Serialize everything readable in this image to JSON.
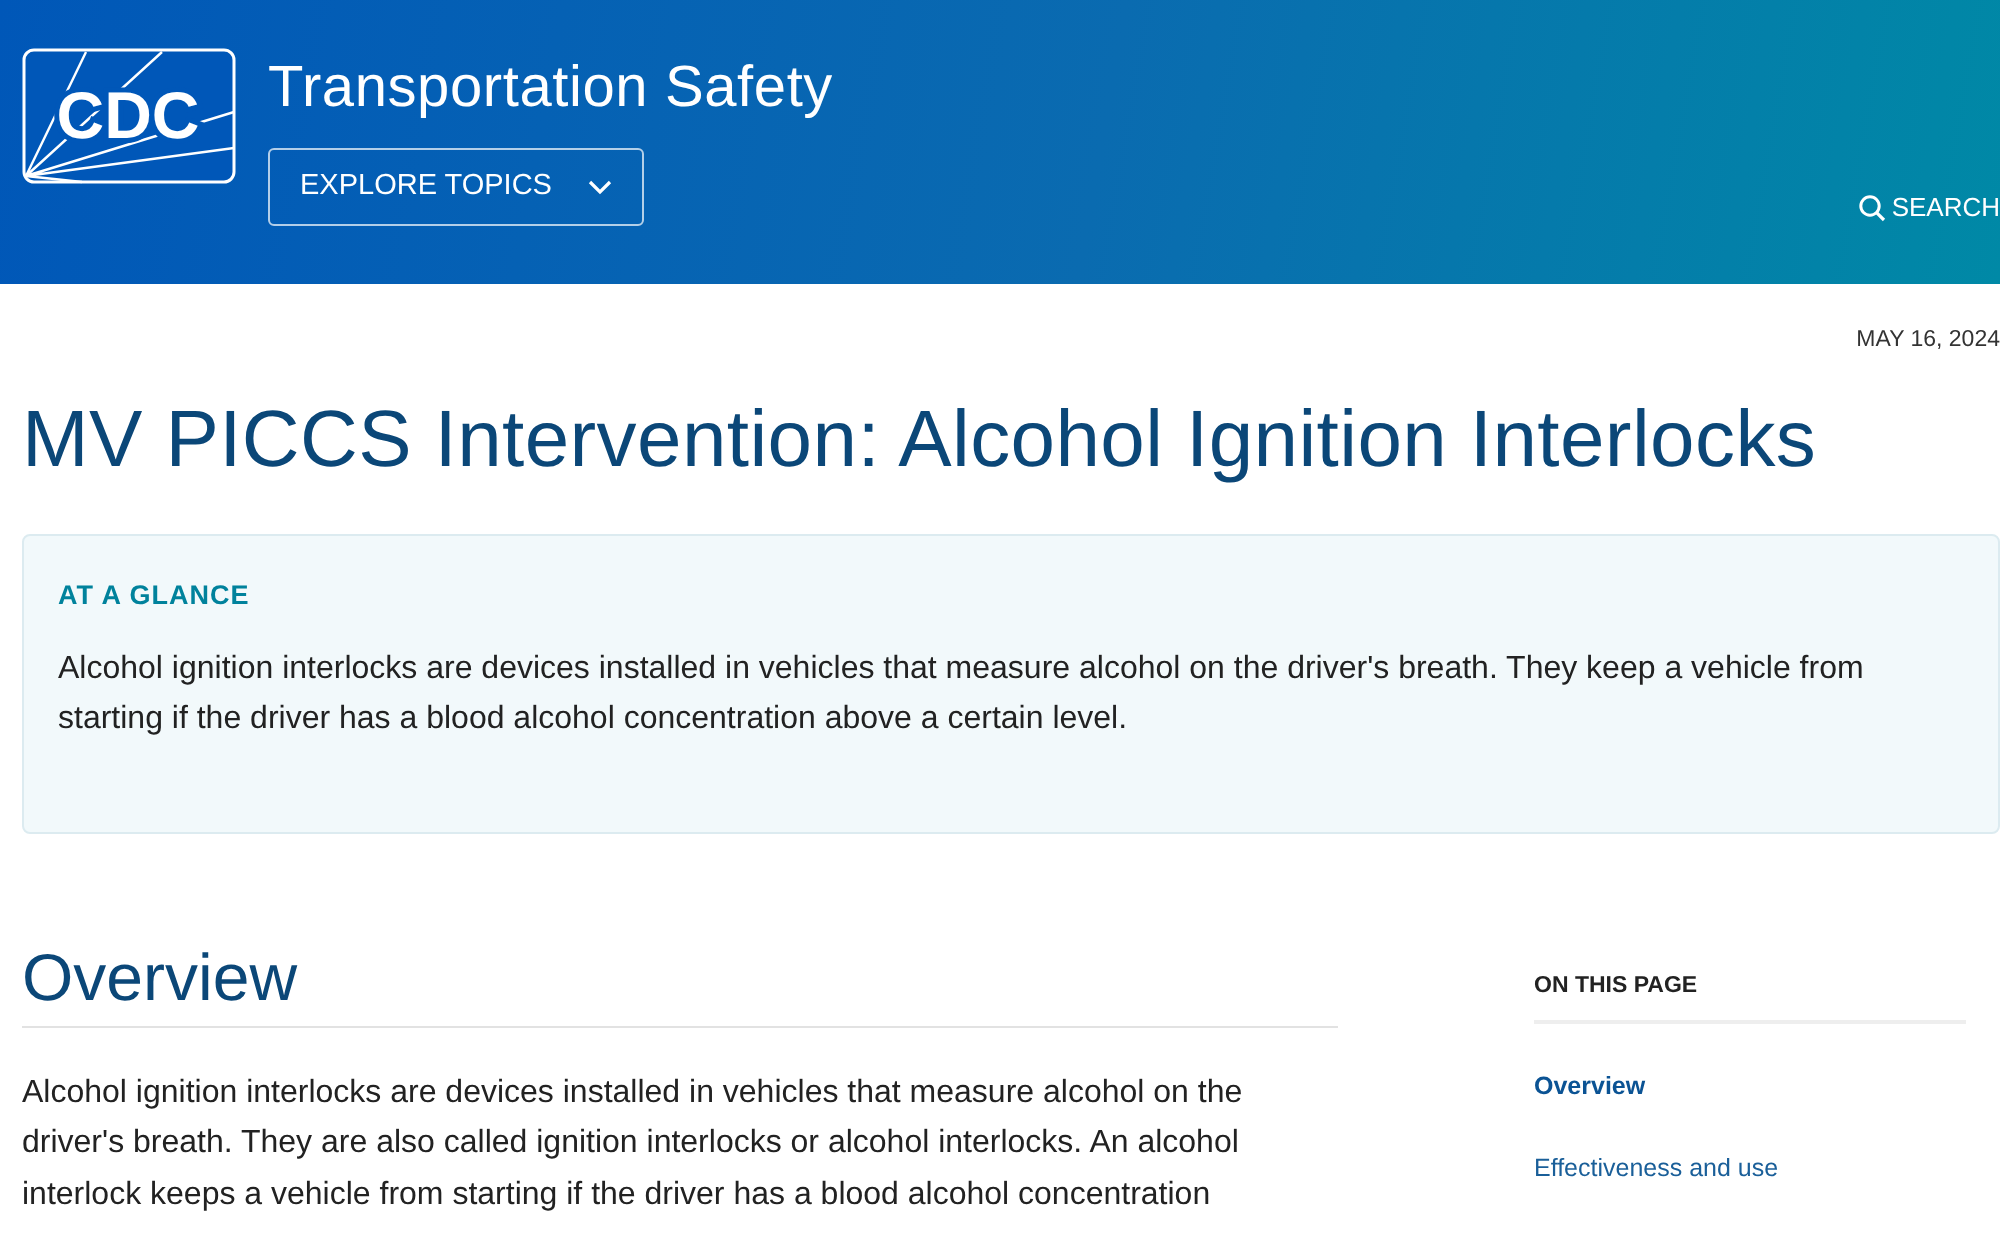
{
  "header": {
    "logo_text": "CDC",
    "site_title": "Transportation Safety",
    "menu_button": "EXPLORE TOPICS",
    "search_label": "SEARCH"
  },
  "date": "MAY 16, 2024",
  "page_title": "MV PICCS Intervention: Alcohol Ignition Interlocks",
  "at_a_glance": {
    "heading": "AT A GLANCE",
    "text": "Alcohol ignition interlocks are devices installed in vehicles that measure alcohol on the driver's breath. They keep a vehicle from starting if the driver has a blood alcohol concentration above a certain level."
  },
  "section": {
    "heading": "Overview",
    "paragraph": "Alcohol ignition interlocks are devices installed in vehicles that measure alcohol on the driver's breath. They are also called ignition interlocks or alcohol interlocks. An alcohol interlock keeps a vehicle from starting if the driver has a blood alcohol concentration"
  },
  "on_this_page": {
    "heading": "ON THIS PAGE",
    "links": [
      {
        "label": "Overview",
        "selected": true
      },
      {
        "label": "Effectiveness and use",
        "selected": false
      }
    ]
  }
}
